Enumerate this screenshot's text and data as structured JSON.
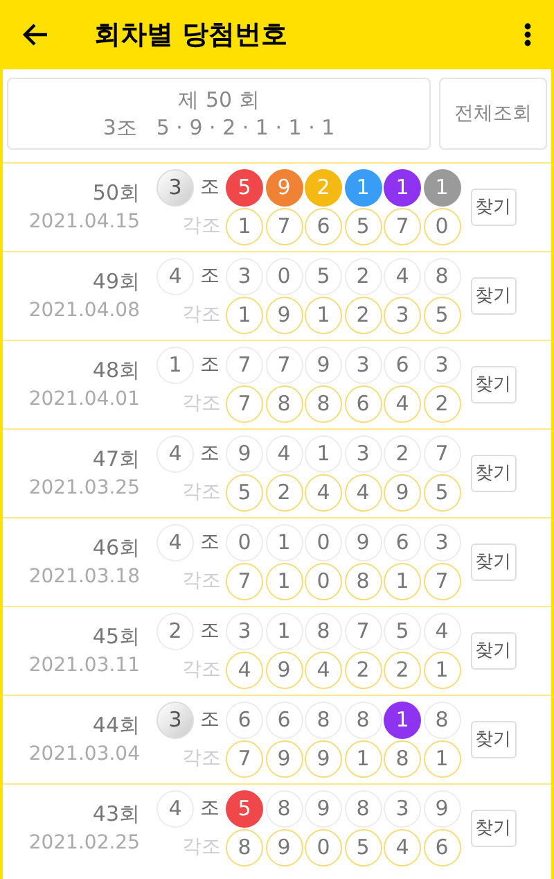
{
  "app_bar": {
    "title": "회차별 당첨번호"
  },
  "summary": {
    "draw_title": "제 50 회",
    "group": "3조",
    "numbers": "5 · 9 · 2 · 1 · 1 · 1",
    "button": "전체조회"
  },
  "rows": [
    {
      "round": "50회",
      "date": "2021.04.15",
      "group": {
        "value": "3",
        "matched": true
      },
      "group_label": "조",
      "balls": [
        {
          "value": "5",
          "matched": true
        },
        {
          "value": "9",
          "matched": true
        },
        {
          "value": "2",
          "matched": true
        },
        {
          "value": "1",
          "matched": true
        },
        {
          "value": "1",
          "matched": true
        },
        {
          "value": "1",
          "matched": true
        }
      ],
      "bonus_label": "각조",
      "bonus": [
        "1",
        "7",
        "6",
        "5",
        "7",
        "0"
      ],
      "button": "찾기"
    },
    {
      "round": "49회",
      "date": "2021.04.08",
      "group": {
        "value": "4",
        "matched": false
      },
      "group_label": "조",
      "balls": [
        {
          "value": "3",
          "matched": false
        },
        {
          "value": "0",
          "matched": false
        },
        {
          "value": "5",
          "matched": false
        },
        {
          "value": "2",
          "matched": false
        },
        {
          "value": "4",
          "matched": false
        },
        {
          "value": "8",
          "matched": false
        }
      ],
      "bonus_label": "각조",
      "bonus": [
        "1",
        "9",
        "1",
        "2",
        "3",
        "5"
      ],
      "button": "찾기"
    },
    {
      "round": "48회",
      "date": "2021.04.01",
      "group": {
        "value": "1",
        "matched": false
      },
      "group_label": "조",
      "balls": [
        {
          "value": "7",
          "matched": false
        },
        {
          "value": "7",
          "matched": false
        },
        {
          "value": "9",
          "matched": false
        },
        {
          "value": "3",
          "matched": false
        },
        {
          "value": "6",
          "matched": false
        },
        {
          "value": "3",
          "matched": false
        }
      ],
      "bonus_label": "각조",
      "bonus": [
        "7",
        "8",
        "8",
        "6",
        "4",
        "2"
      ],
      "button": "찾기"
    },
    {
      "round": "47회",
      "date": "2021.03.25",
      "group": {
        "value": "4",
        "matched": false
      },
      "group_label": "조",
      "balls": [
        {
          "value": "9",
          "matched": false
        },
        {
          "value": "4",
          "matched": false
        },
        {
          "value": "1",
          "matched": false
        },
        {
          "value": "3",
          "matched": false
        },
        {
          "value": "2",
          "matched": false
        },
        {
          "value": "7",
          "matched": false
        }
      ],
      "bonus_label": "각조",
      "bonus": [
        "5",
        "2",
        "4",
        "4",
        "9",
        "5"
      ],
      "button": "찾기"
    },
    {
      "round": "46회",
      "date": "2021.03.18",
      "group": {
        "value": "4",
        "matched": false
      },
      "group_label": "조",
      "balls": [
        {
          "value": "0",
          "matched": false
        },
        {
          "value": "1",
          "matched": false
        },
        {
          "value": "0",
          "matched": false
        },
        {
          "value": "9",
          "matched": false
        },
        {
          "value": "6",
          "matched": false
        },
        {
          "value": "3",
          "matched": false
        }
      ],
      "bonus_label": "각조",
      "bonus": [
        "7",
        "1",
        "0",
        "8",
        "1",
        "7"
      ],
      "button": "찾기"
    },
    {
      "round": "45회",
      "date": "2021.03.11",
      "group": {
        "value": "2",
        "matched": false
      },
      "group_label": "조",
      "balls": [
        {
          "value": "3",
          "matched": false
        },
        {
          "value": "1",
          "matched": false
        },
        {
          "value": "8",
          "matched": false
        },
        {
          "value": "7",
          "matched": false
        },
        {
          "value": "5",
          "matched": false
        },
        {
          "value": "4",
          "matched": false
        }
      ],
      "bonus_label": "각조",
      "bonus": [
        "4",
        "9",
        "4",
        "2",
        "2",
        "1"
      ],
      "button": "찾기"
    },
    {
      "round": "44회",
      "date": "2021.03.04",
      "group": {
        "value": "3",
        "matched": true
      },
      "group_label": "조",
      "balls": [
        {
          "value": "6",
          "matched": false
        },
        {
          "value": "6",
          "matched": false
        },
        {
          "value": "8",
          "matched": false
        },
        {
          "value": "8",
          "matched": false
        },
        {
          "value": "1",
          "matched": true
        },
        {
          "value": "8",
          "matched": false
        }
      ],
      "bonus_label": "각조",
      "bonus": [
        "7",
        "9",
        "9",
        "1",
        "8",
        "1"
      ],
      "button": "찾기"
    },
    {
      "round": "43회",
      "date": "2021.02.25",
      "group": {
        "value": "4",
        "matched": false
      },
      "group_label": "조",
      "balls": [
        {
          "value": "5",
          "matched": true
        },
        {
          "value": "8",
          "matched": false
        },
        {
          "value": "9",
          "matched": false
        },
        {
          "value": "8",
          "matched": false
        },
        {
          "value": "3",
          "matched": false
        },
        {
          "value": "9",
          "matched": false
        }
      ],
      "bonus_label": "각조",
      "bonus": [
        "8",
        "9",
        "0",
        "5",
        "4",
        "6"
      ],
      "button": "찾기"
    }
  ]
}
